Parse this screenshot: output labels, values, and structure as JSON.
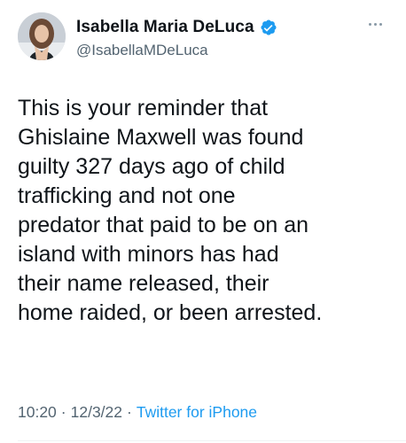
{
  "author": {
    "display_name": "Isabella Maria DeLuca",
    "handle": "@IsabellaMDeLuca",
    "verified": true
  },
  "icons": {
    "verified": "verified-badge-icon",
    "more": "more-options-icon",
    "avatar": "profile-avatar"
  },
  "colors": {
    "verified_blue": "#1d9bf0",
    "link_blue": "#1d9bf0",
    "muted_gray": "#536471",
    "text": "#0f1419"
  },
  "tweet": {
    "text": "This is your reminder that\nGhislaine Maxwell was found\nguilty 327 days ago of child\ntrafficking and not one\npredator that paid to be on an\nisland with minors has had\ntheir name released, their\nhome raided, or been arrested."
  },
  "meta": {
    "time": "10:20",
    "separator": "·",
    "date": "12/3/22",
    "source": "Twitter for iPhone"
  }
}
